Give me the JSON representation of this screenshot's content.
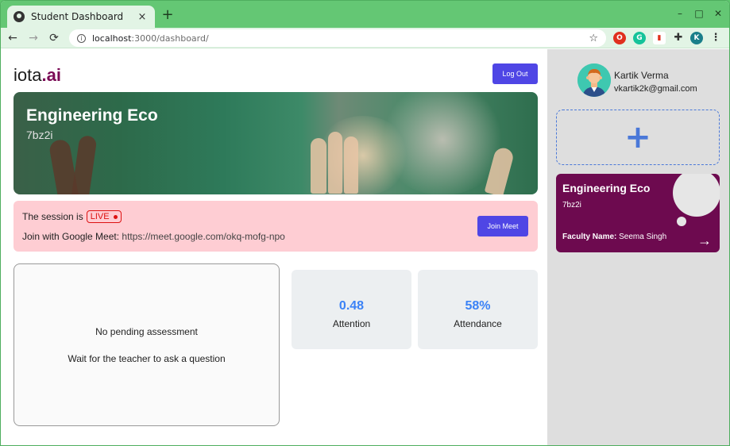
{
  "browser": {
    "tab_title": "Student Dashboard",
    "tab_close": "×",
    "new_tab": "+",
    "url_host": "localhost",
    "url_path": ":3000/dashboard/",
    "minimize": "–",
    "maximize": "□",
    "close": "✕",
    "profile_initial": "K"
  },
  "header": {
    "logo_main": "iota",
    "logo_accent": ".ai",
    "logout_label": "Log Out"
  },
  "banner": {
    "title": "Engineering Eco",
    "code": "7bz2i"
  },
  "session": {
    "prefix": "The session is",
    "live_label": "LIVE",
    "join_prefix": "Join with Google Meet:",
    "meet_url": "https://meet.google.com/okq-mofg-npo",
    "join_label": "Join Meet"
  },
  "assessment": {
    "line1": "No pending assessment",
    "line2": "Wait for the teacher to ask a question"
  },
  "stats": [
    {
      "value": "0.48",
      "label": "Attention"
    },
    {
      "value": "58%",
      "label": "Attendance"
    }
  ],
  "sidebar": {
    "user_name": "Kartik Verma",
    "user_email": "vkartik2k@gmail.com",
    "add_label": "+",
    "course": {
      "name": "Engineering Eco",
      "code": "7bz2i",
      "faculty_prefix": "Faculty Name:",
      "faculty_name": "Seema Singh",
      "arrow": "→"
    }
  },
  "colors": {
    "accent": "#4f46e5",
    "brand": "#7a0a55",
    "stat_value": "#3b82f6",
    "live_bg": "#fecdd3",
    "course_card": "#6d0a4f"
  }
}
